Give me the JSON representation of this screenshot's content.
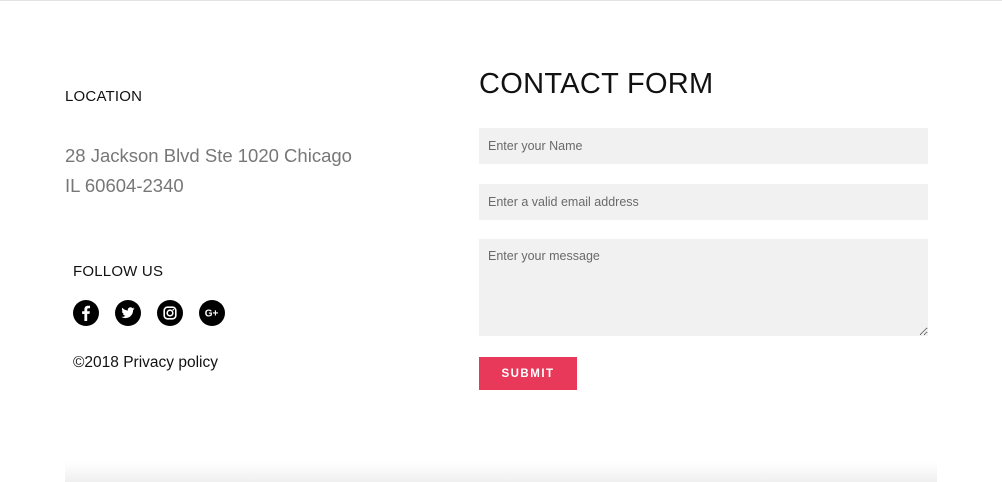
{
  "location": {
    "heading": "LOCATION",
    "address_line1": "28 Jackson Blvd Ste 1020 Chicago",
    "address_line2": "IL 60604-2340"
  },
  "follow": {
    "heading": "FOLLOW US",
    "icons": [
      "facebook-icon",
      "twitter-icon",
      "instagram-icon",
      "google-plus-icon"
    ]
  },
  "footer": {
    "copyright": "©2018 Privacy policy"
  },
  "contact_form": {
    "title": "CONTACT FORM",
    "name_placeholder": "Enter your Name",
    "email_placeholder": "Enter a valid email address",
    "message_placeholder": "Enter your message",
    "submit_label": "SUBMIT"
  },
  "colors": {
    "accent": "#e8395a",
    "field_background": "#f1f1f1",
    "address_text": "#777777"
  }
}
